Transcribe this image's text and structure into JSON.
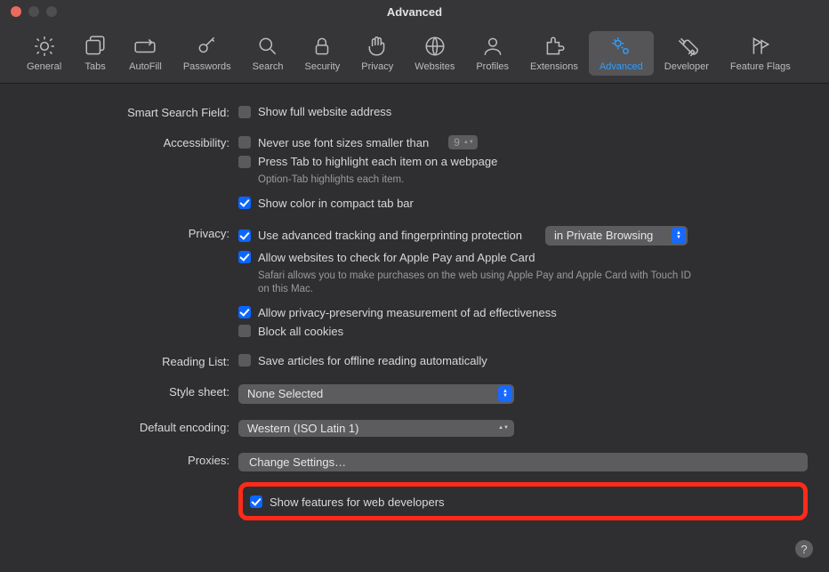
{
  "title": "Advanced",
  "toolbar": [
    {
      "label": "General",
      "icon": "gear"
    },
    {
      "label": "Tabs",
      "icon": "tabs"
    },
    {
      "label": "AutoFill",
      "icon": "pencil"
    },
    {
      "label": "Passwords",
      "icon": "key"
    },
    {
      "label": "Search",
      "icon": "search"
    },
    {
      "label": "Security",
      "icon": "lock"
    },
    {
      "label": "Privacy",
      "icon": "hand"
    },
    {
      "label": "Websites",
      "icon": "globe"
    },
    {
      "label": "Profiles",
      "icon": "person"
    },
    {
      "label": "Extensions",
      "icon": "puzzle"
    },
    {
      "label": "Advanced",
      "icon": "gears"
    },
    {
      "label": "Developer",
      "icon": "tools"
    },
    {
      "label": "Feature Flags",
      "icon": "flags"
    }
  ],
  "sections": {
    "smart_search": {
      "label": "Smart Search Field:",
      "show_full_url": "Show full website address"
    },
    "accessibility": {
      "label": "Accessibility:",
      "font_size": "Never use font sizes smaller than",
      "font_size_value": "9",
      "press_tab": "Press Tab to highlight each item on a webpage",
      "press_tab_hint": "Option-Tab highlights each item.",
      "compact_tab": "Show color in compact tab bar"
    },
    "privacy": {
      "label": "Privacy:",
      "tracking": "Use advanced tracking and fingerprinting protection",
      "tracking_scope": "in Private Browsing",
      "apple_pay": "Allow websites to check for Apple Pay and Apple Card",
      "apple_pay_hint": "Safari allows you to make purchases on the web using Apple Pay and Apple Card with Touch ID on this Mac.",
      "ad_measure": "Allow privacy-preserving measurement of ad effectiveness",
      "block_cookies": "Block all cookies"
    },
    "reading_list": {
      "label": "Reading List:",
      "offline": "Save articles for offline reading automatically"
    },
    "stylesheet": {
      "label": "Style sheet:",
      "value": "None Selected"
    },
    "encoding": {
      "label": "Default encoding:",
      "value": "Western (ISO Latin 1)"
    },
    "proxies": {
      "label": "Proxies:",
      "button": "Change Settings…"
    },
    "developer": {
      "show_dev": "Show features for web developers"
    }
  },
  "help": "?"
}
